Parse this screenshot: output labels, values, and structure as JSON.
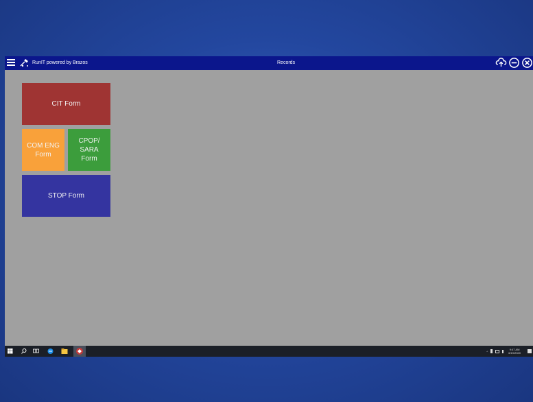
{
  "titlebar": {
    "app_name": "RunIT powered by Brazos",
    "page_title": "Records",
    "icons": [
      "menu-icon",
      "satellite-icon",
      "cloud-sync-icon",
      "minimize-icon",
      "close-icon"
    ]
  },
  "tiles": [
    {
      "line1": "CIT Form",
      "line2": "",
      "line3": "",
      "color": "#9f3433"
    },
    {
      "line1": "COM ENG",
      "line2": "Form",
      "line3": "",
      "color": "#f9a13a"
    },
    {
      "line1": "CPOP/",
      "line2": "SARA",
      "line3": "Form",
      "color": "#3c9d3c"
    },
    {
      "line1": "STOP Form",
      "line2": "",
      "line3": "",
      "color": "#3434a0"
    }
  ],
  "taskbar": {
    "icons": [
      "windows-start-icon",
      "search-icon",
      "task-view-icon",
      "edge-browser-icon",
      "file-explorer-icon",
      "runit-app-icon"
    ],
    "clock_time": "9:47 AM",
    "clock_date": "6/19/2020"
  },
  "colors": {
    "titlebar": "#0b168c",
    "workspace": "#a0a0a0",
    "taskbar": "#1b1f27"
  }
}
